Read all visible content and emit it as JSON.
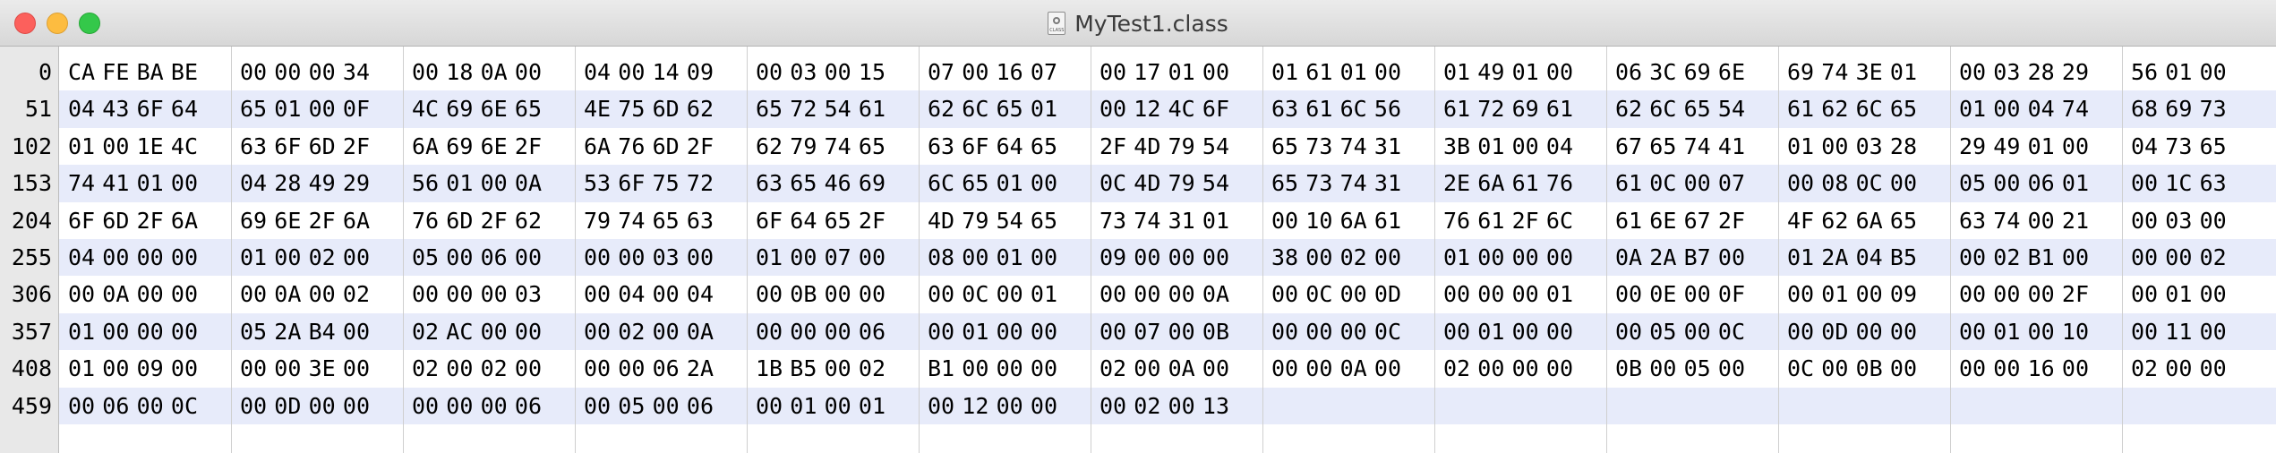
{
  "window": {
    "title": "MyTest1.class",
    "file_icon": "class-file-icon"
  },
  "colors": {
    "row_alt": "#e7ebfa",
    "gutter": "#e8e8e8"
  },
  "rows": [
    {
      "offset": "0",
      "bytes": [
        "CA",
        "FE",
        "BA",
        "BE",
        "00",
        "00",
        "00",
        "34",
        "00",
        "18",
        "0A",
        "00",
        "04",
        "00",
        "14",
        "09",
        "00",
        "03",
        "00",
        "15",
        "07",
        "00",
        "16",
        "07",
        "00",
        "17",
        "01",
        "00",
        "01",
        "61",
        "01",
        "00",
        "01",
        "49",
        "01",
        "00",
        "06",
        "3C",
        "69",
        "6E",
        "69",
        "74",
        "3E",
        "01",
        "00",
        "03",
        "28",
        "29",
        "56",
        "01",
        "00"
      ]
    },
    {
      "offset": "51",
      "bytes": [
        "04",
        "43",
        "6F",
        "64",
        "65",
        "01",
        "00",
        "0F",
        "4C",
        "69",
        "6E",
        "65",
        "4E",
        "75",
        "6D",
        "62",
        "65",
        "72",
        "54",
        "61",
        "62",
        "6C",
        "65",
        "01",
        "00",
        "12",
        "4C",
        "6F",
        "63",
        "61",
        "6C",
        "56",
        "61",
        "72",
        "69",
        "61",
        "62",
        "6C",
        "65",
        "54",
        "61",
        "62",
        "6C",
        "65",
        "01",
        "00",
        "04",
        "74",
        "68",
        "69",
        "73"
      ]
    },
    {
      "offset": "102",
      "bytes": [
        "01",
        "00",
        "1E",
        "4C",
        "63",
        "6F",
        "6D",
        "2F",
        "6A",
        "69",
        "6E",
        "2F",
        "6A",
        "76",
        "6D",
        "2F",
        "62",
        "79",
        "74",
        "65",
        "63",
        "6F",
        "64",
        "65",
        "2F",
        "4D",
        "79",
        "54",
        "65",
        "73",
        "74",
        "31",
        "3B",
        "01",
        "00",
        "04",
        "67",
        "65",
        "74",
        "41",
        "01",
        "00",
        "03",
        "28",
        "29",
        "49",
        "01",
        "00",
        "04",
        "73",
        "65"
      ]
    },
    {
      "offset": "153",
      "bytes": [
        "74",
        "41",
        "01",
        "00",
        "04",
        "28",
        "49",
        "29",
        "56",
        "01",
        "00",
        "0A",
        "53",
        "6F",
        "75",
        "72",
        "63",
        "65",
        "46",
        "69",
        "6C",
        "65",
        "01",
        "00",
        "0C",
        "4D",
        "79",
        "54",
        "65",
        "73",
        "74",
        "31",
        "2E",
        "6A",
        "61",
        "76",
        "61",
        "0C",
        "00",
        "07",
        "00",
        "08",
        "0C",
        "00",
        "05",
        "00",
        "06",
        "01",
        "00",
        "1C",
        "63"
      ]
    },
    {
      "offset": "204",
      "bytes": [
        "6F",
        "6D",
        "2F",
        "6A",
        "69",
        "6E",
        "2F",
        "6A",
        "76",
        "6D",
        "2F",
        "62",
        "79",
        "74",
        "65",
        "63",
        "6F",
        "64",
        "65",
        "2F",
        "4D",
        "79",
        "54",
        "65",
        "73",
        "74",
        "31",
        "01",
        "00",
        "10",
        "6A",
        "61",
        "76",
        "61",
        "2F",
        "6C",
        "61",
        "6E",
        "67",
        "2F",
        "4F",
        "62",
        "6A",
        "65",
        "63",
        "74",
        "00",
        "21",
        "00",
        "03",
        "00"
      ]
    },
    {
      "offset": "255",
      "bytes": [
        "04",
        "00",
        "00",
        "00",
        "01",
        "00",
        "02",
        "00",
        "05",
        "00",
        "06",
        "00",
        "00",
        "00",
        "03",
        "00",
        "01",
        "00",
        "07",
        "00",
        "08",
        "00",
        "01",
        "00",
        "09",
        "00",
        "00",
        "00",
        "38",
        "00",
        "02",
        "00",
        "01",
        "00",
        "00",
        "00",
        "0A",
        "2A",
        "B7",
        "00",
        "01",
        "2A",
        "04",
        "B5",
        "00",
        "02",
        "B1",
        "00",
        "00",
        "00",
        "02"
      ]
    },
    {
      "offset": "306",
      "bytes": [
        "00",
        "0A",
        "00",
        "00",
        "00",
        "0A",
        "00",
        "02",
        "00",
        "00",
        "00",
        "03",
        "00",
        "04",
        "00",
        "04",
        "00",
        "0B",
        "00",
        "00",
        "00",
        "0C",
        "00",
        "01",
        "00",
        "00",
        "00",
        "0A",
        "00",
        "0C",
        "00",
        "0D",
        "00",
        "00",
        "00",
        "01",
        "00",
        "0E",
        "00",
        "0F",
        "00",
        "01",
        "00",
        "09",
        "00",
        "00",
        "00",
        "2F",
        "00",
        "01",
        "00"
      ]
    },
    {
      "offset": "357",
      "bytes": [
        "01",
        "00",
        "00",
        "00",
        "05",
        "2A",
        "B4",
        "00",
        "02",
        "AC",
        "00",
        "00",
        "00",
        "02",
        "00",
        "0A",
        "00",
        "00",
        "00",
        "06",
        "00",
        "01",
        "00",
        "00",
        "00",
        "07",
        "00",
        "0B",
        "00",
        "00",
        "00",
        "0C",
        "00",
        "01",
        "00",
        "00",
        "00",
        "05",
        "00",
        "0C",
        "00",
        "0D",
        "00",
        "00",
        "00",
        "01",
        "00",
        "10",
        "00",
        "11",
        "00"
      ]
    },
    {
      "offset": "408",
      "bytes": [
        "01",
        "00",
        "09",
        "00",
        "00",
        "00",
        "3E",
        "00",
        "02",
        "00",
        "02",
        "00",
        "00",
        "00",
        "06",
        "2A",
        "1B",
        "B5",
        "00",
        "02",
        "B1",
        "00",
        "00",
        "00",
        "02",
        "00",
        "0A",
        "00",
        "00",
        "00",
        "0A",
        "00",
        "02",
        "00",
        "00",
        "00",
        "0B",
        "00",
        "05",
        "00",
        "0C",
        "00",
        "0B",
        "00",
        "00",
        "00",
        "16",
        "00",
        "02",
        "00",
        "00"
      ]
    },
    {
      "offset": "459",
      "bytes": [
        "00",
        "06",
        "00",
        "0C",
        "00",
        "0D",
        "00",
        "00",
        "00",
        "00",
        "00",
        "06",
        "00",
        "05",
        "00",
        "06",
        "00",
        "01",
        "00",
        "01",
        "00",
        "12",
        "00",
        "00",
        "00",
        "02",
        "00",
        "13"
      ]
    }
  ]
}
